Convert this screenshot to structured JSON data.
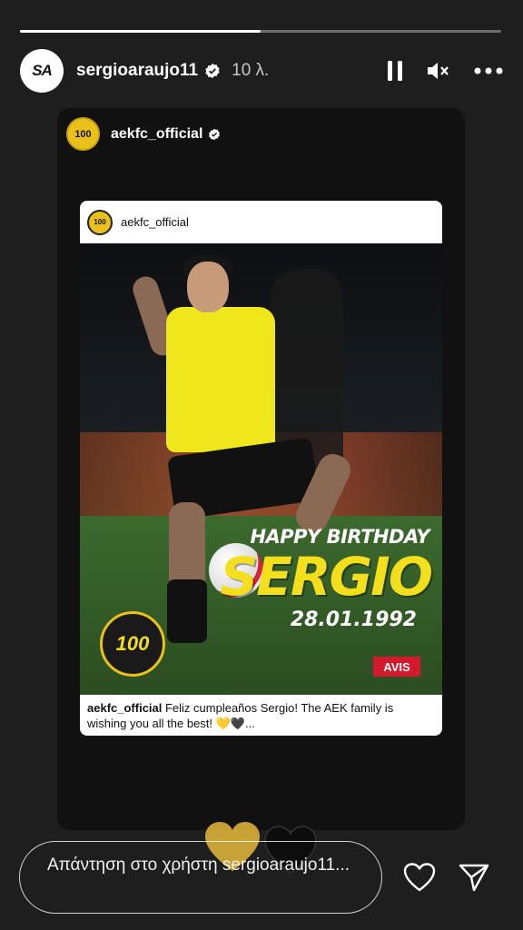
{
  "story": {
    "progress_fraction": 0.5
  },
  "header": {
    "avatar_text": "SA",
    "username": "sergioaraujo11",
    "time_ago": "10 λ.",
    "icons": [
      "pause-icon",
      "mute-icon",
      "more-icon"
    ]
  },
  "shared": {
    "account": "aekfc_official",
    "logo_text": "100"
  },
  "post": {
    "account": "aekfc_official",
    "greeting": "HAPPY BIRTHDAY",
    "name": "SERGIO",
    "date": "28.01.1992",
    "badge_text": "100",
    "sponsor": "AVIS",
    "caption_user": "aekfc_official",
    "caption_text": " Feliz cumpleaños Sergio! The AEK family is wishing you all the best! 💛🖤..."
  },
  "reply": {
    "placeholder": "Απάντηση στο χρήστη sergioaraujo11..."
  },
  "colors": {
    "background": "#1e1e1e",
    "aek_yellow": "#f3df1c",
    "sponsor_red": "#d3192b"
  }
}
